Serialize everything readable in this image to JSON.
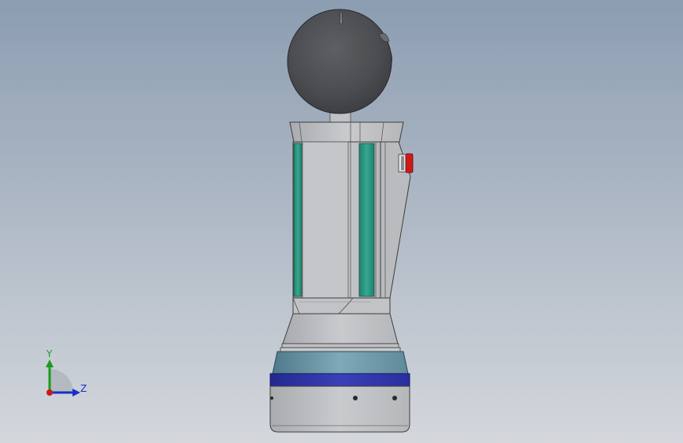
{
  "viewport": {
    "background_top": "#8c9db1",
    "background_bottom": "#d4d7dc"
  },
  "model": {
    "parts": [
      "sphere-head",
      "neck",
      "top-cap",
      "column-body",
      "side-panel",
      "red-button",
      "lower-collar",
      "flared-skirt",
      "blue-gray-band",
      "blue-band",
      "base-cylinder"
    ],
    "colors": {
      "sphere": "#4d4f52",
      "metal_light": "#c8c9cc",
      "metal_mid": "#9fa1a5",
      "green_strip": "#2e9d86",
      "band_bluegray": "#6f98a8",
      "band_blue": "#2d32a6",
      "button_red": "#d01a1a"
    }
  },
  "triad": {
    "y_label": "Y",
    "z_label": "Z",
    "y_color": "#1b9a1b",
    "z_color": "#1a2fc8",
    "x_color": "#c81a1a"
  }
}
